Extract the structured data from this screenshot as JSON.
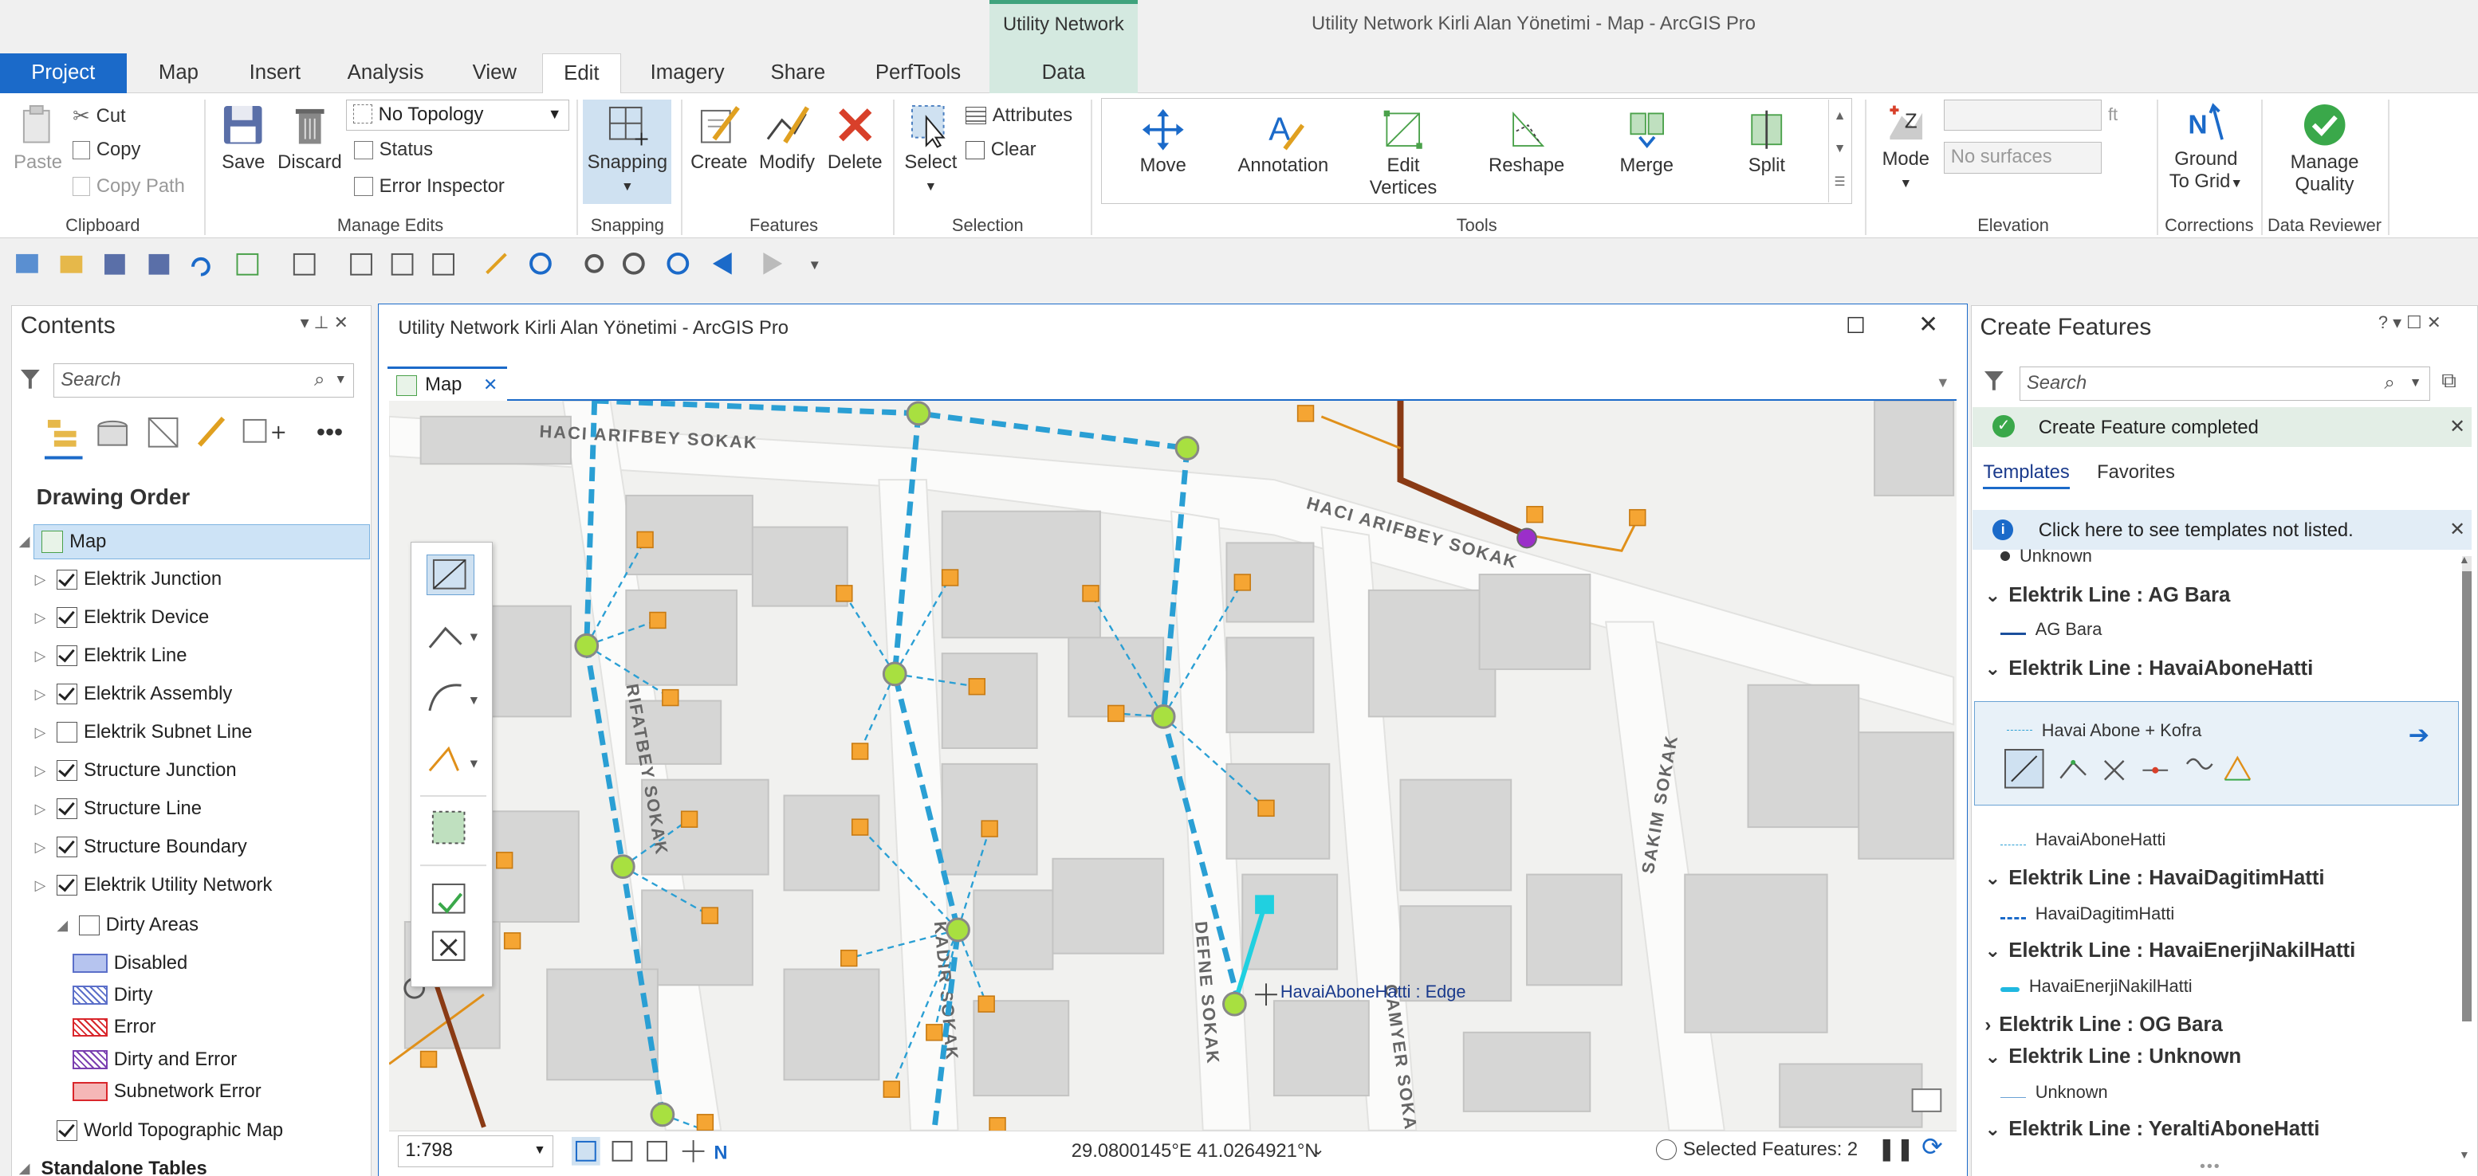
{
  "window": {
    "title": "Utility Network Kirli Alan Yönetimi - Map - ArcGIS Pro",
    "context_tab_group": "Utility Network"
  },
  "tabs": [
    "Project",
    "Map",
    "Insert",
    "Analysis",
    "View",
    "Edit",
    "Imagery",
    "Share",
    "PerfTools",
    "Data"
  ],
  "ribbon": {
    "clipboard": {
      "label": "Clipboard",
      "paste": "Paste",
      "cut": "Cut",
      "copy": "Copy",
      "copy_path": "Copy Path"
    },
    "manage_edits": {
      "label": "Manage Edits",
      "save": "Save",
      "discard": "Discard",
      "topology": "No Topology",
      "status": "Status",
      "error_inspector": "Error Inspector"
    },
    "snapping": {
      "label": "Snapping",
      "button": "Snapping"
    },
    "features": {
      "label": "Features",
      "create": "Create",
      "modify": "Modify",
      "delete": "Delete"
    },
    "selection": {
      "label": "Selection",
      "select": "Select",
      "attributes": "Attributes",
      "clear": "Clear"
    },
    "tools": {
      "label": "Tools",
      "move": "Move",
      "annotation": "Annotation",
      "edit_vertices_1": "Edit",
      "edit_vertices_2": "Vertices",
      "reshape": "Reshape",
      "merge": "Merge",
      "split": "Split"
    },
    "elevation": {
      "label": "Elevation",
      "mode": "Mode",
      "surfaces": "No surfaces",
      "unit": "ft"
    },
    "corrections": {
      "label": "Corrections",
      "ground_1": "Ground",
      "ground_2": "To Grid"
    },
    "data_reviewer": {
      "label": "Data Reviewer",
      "mq_1": "Manage",
      "mq_2": "Quality"
    }
  },
  "contents": {
    "title": "Contents",
    "search_placeholder": "Search",
    "drawing_order": "Drawing Order",
    "map_name": "Map",
    "layers": [
      {
        "name": "Elektrik Junction",
        "checked": true
      },
      {
        "name": "Elektrik Device",
        "checked": true
      },
      {
        "name": "Elektrik Line",
        "checked": true
      },
      {
        "name": "Elektrik Assembly",
        "checked": true
      },
      {
        "name": "Elektrik Subnet Line",
        "checked": false
      },
      {
        "name": "Structure Junction",
        "checked": true
      },
      {
        "name": "Structure Line",
        "checked": true
      },
      {
        "name": "Structure Boundary",
        "checked": true
      },
      {
        "name": "Elektrik Utility Network",
        "checked": true
      }
    ],
    "dirty_areas": "Dirty Areas",
    "dirty_items": [
      {
        "name": "Disabled",
        "fill": "#b6c4ef",
        "stroke": "#5b6fc9",
        "hatch": false
      },
      {
        "name": "Dirty",
        "fill": "#ffffff",
        "stroke": "#5b6fc9",
        "hatch": true
      },
      {
        "name": "Error",
        "fill": "#ffffff",
        "stroke": "#d9262b",
        "hatch": true
      },
      {
        "name": "Dirty and Error",
        "fill": "#ffffff",
        "stroke": "#7a3fb0",
        "hatch": true
      },
      {
        "name": "Subnetwork Error",
        "fill": "#f5b7b7",
        "stroke": "#d9262b",
        "hatch": false
      }
    ],
    "basemap": "World Topographic Map",
    "standalone": "Standalone Tables"
  },
  "mapview": {
    "window_title": "Utility Network Kirli Alan Yönetimi - ArcGIS Pro",
    "tab_label": "Map",
    "streets": [
      "HACI ARIFBEY SOKAK",
      "HACI ARIFBEY SOKAK",
      "RIFATBEY SOKAK",
      "KADIR SOKAK",
      "DEFNE SOKAK",
      "CAMYER SOKAK",
      "SAKIM SOKAK"
    ],
    "snap_tip": "HavaiAboneHatti : Edge",
    "scale": "1:798",
    "coords": "29.0800145°E 41.0264921°N",
    "selected": "Selected Features: 2"
  },
  "create_features": {
    "title": "Create Features",
    "search_placeholder": "Search",
    "banner": "Create Feature completed",
    "tab_templates": "Templates",
    "tab_favorites": "Favorites",
    "info": "Click here to see templates not listed.",
    "partial_item": "Unknown",
    "groups": [
      {
        "name": "Elektrik Line : AG Bara",
        "item": "AG Bara"
      },
      {
        "name": "Elektrik Line : HavaiAboneHatti",
        "item": "HavaiAboneHatti"
      },
      {
        "name": "Elektrik Line : HavaiDagitimHatti",
        "item": "HavaiDagitimHatti"
      },
      {
        "name": "Elektrik Line : HavaiEnerjiNakilHatti",
        "item": "HavaiEnerjiNakilHatti"
      },
      {
        "name": "Elektrik Line : OG Bara",
        "item": ""
      },
      {
        "name": "Elektrik Line : Unknown",
        "item": "Unknown"
      },
      {
        "name": "Elektrik Line : YeraltiAboneHatti",
        "item": ""
      }
    ],
    "selected_template": "Havai Abone + Kofra"
  }
}
